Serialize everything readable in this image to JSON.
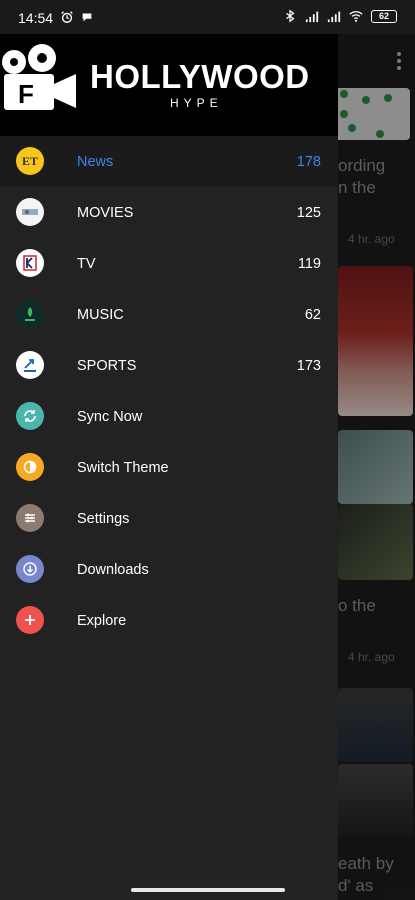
{
  "status": {
    "time": "14:54",
    "battery": "62"
  },
  "brand": {
    "title": "HOLLYWOOD",
    "subtitle": "HYPE"
  },
  "menu": {
    "items": [
      {
        "label": "News",
        "count": "178",
        "icon": "et-logo-icon",
        "active": true
      },
      {
        "label": "MOVIES",
        "count": "125",
        "icon": "movies-source-icon"
      },
      {
        "label": "TV",
        "count": "119",
        "icon": "tv-source-icon"
      },
      {
        "label": "MUSIC",
        "count": "62",
        "icon": "music-source-icon"
      },
      {
        "label": "SPORTS",
        "count": "173",
        "icon": "sports-source-icon"
      },
      {
        "label": "Sync Now",
        "icon": "sync-icon"
      },
      {
        "label": "Switch Theme",
        "icon": "theme-icon"
      },
      {
        "label": "Settings",
        "icon": "settings-sliders-icon"
      },
      {
        "label": "Downloads",
        "icon": "download-icon"
      },
      {
        "label": "Explore",
        "icon": "plus-icon"
      }
    ]
  },
  "background": {
    "headline_1a": "ording",
    "headline_1b": "n the",
    "time_1": "4 hr. ago",
    "headline_2": "o the",
    "time_2": "4 hr. ago",
    "headline_3a": "eath by",
    "headline_3b": "d' as"
  },
  "colors": {
    "drawer_bg": "#222222",
    "active_accent": "#3f83e6",
    "sync": "#4db6ac",
    "theme": "#f9a825",
    "settings": "#8d7b72",
    "downloads": "#7986cb",
    "explore": "#ef5350"
  }
}
